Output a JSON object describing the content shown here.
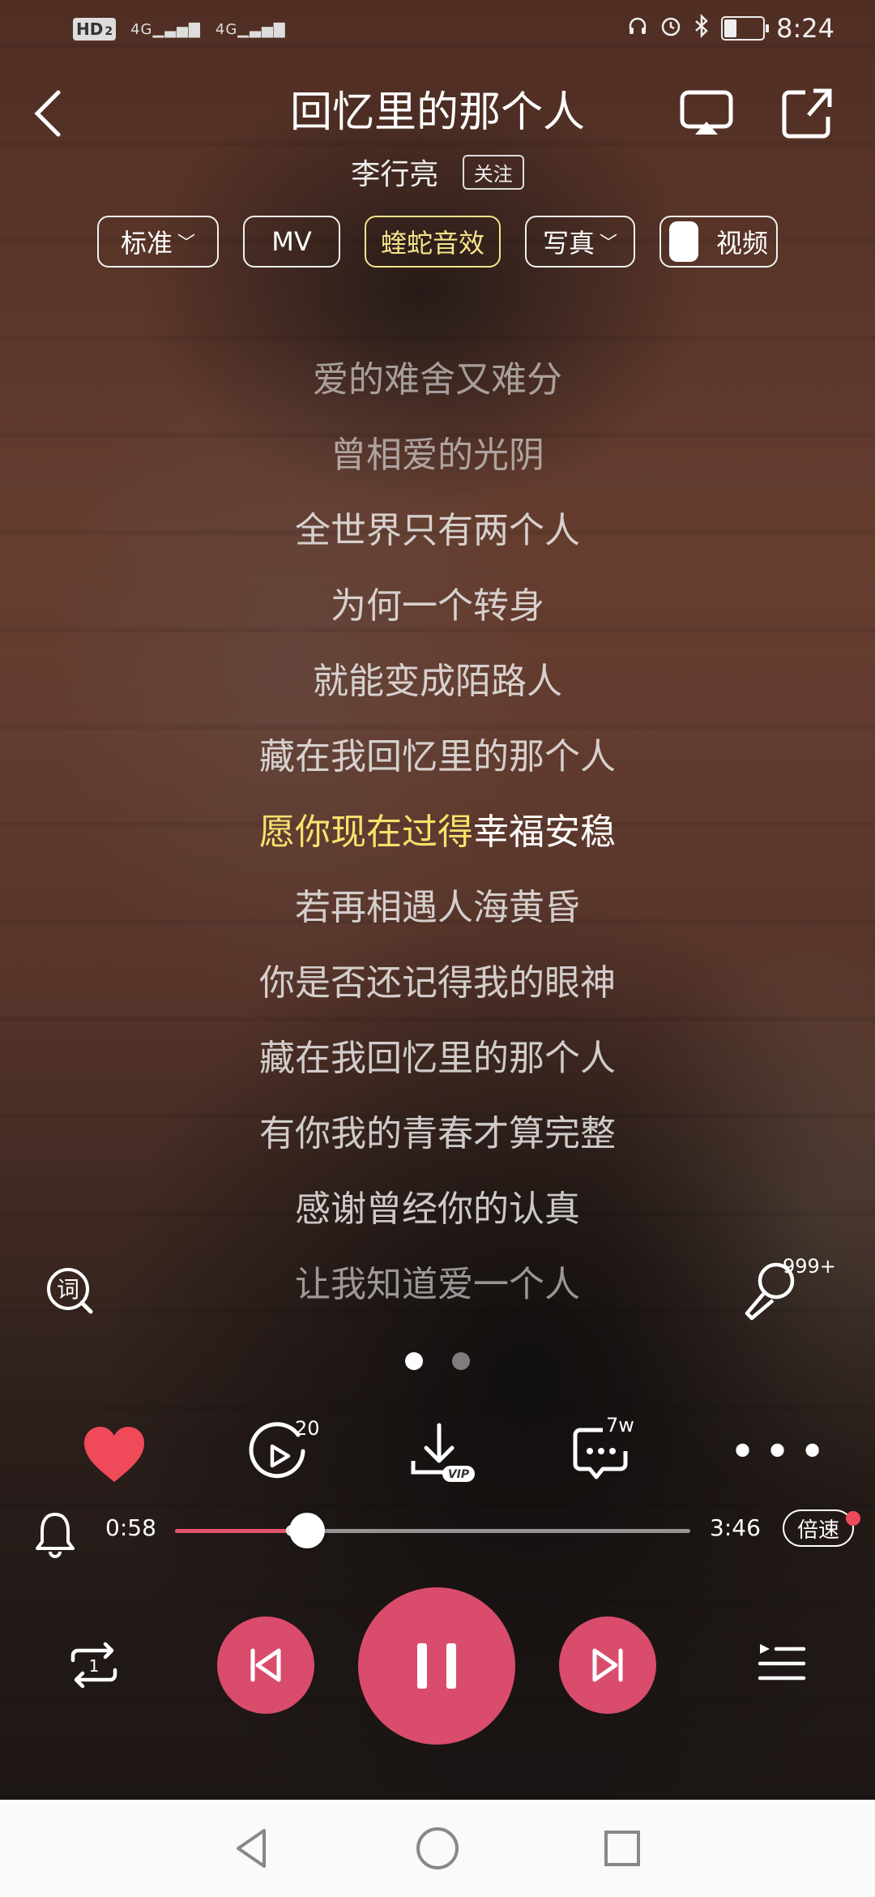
{
  "status_bar": {
    "hd_label": "HD",
    "sim_label": "2",
    "net1": "4G",
    "net2": "4G",
    "time": "8:24"
  },
  "header": {
    "title": "回忆里的那个人",
    "artist": "李行亮",
    "follow_label": "关注"
  },
  "options": {
    "quality": "标准",
    "mv": "MV",
    "effect": "蝰蛇音效",
    "photo": "写真",
    "video": "视频"
  },
  "lyrics": [
    {
      "text": "爱的难舍又难分",
      "state": "dim"
    },
    {
      "text": "曾相爱的光阴",
      "state": "dim"
    },
    {
      "text": "全世界只有两个人",
      "state": "normal"
    },
    {
      "text": "为何一个转身",
      "state": "normal"
    },
    {
      "text": "就能变成陌路人",
      "state": "normal"
    },
    {
      "text": "藏在我回忆里的那个人",
      "state": "normal"
    },
    {
      "text": "愿你现在过得幸福安稳",
      "state": "current",
      "highlighted": "愿你现在过得",
      "rest": "幸福安稳"
    },
    {
      "text": "若再相遇人海黄昏",
      "state": "normal"
    },
    {
      "text": "你是否还记得我的眼神",
      "state": "normal"
    },
    {
      "text": "藏在我回忆里的那个人",
      "state": "normal"
    },
    {
      "text": "有你我的青春才算完整",
      "state": "normal"
    },
    {
      "text": "感谢曾经你的认真",
      "state": "normal"
    },
    {
      "text": "让我知道爱一个人",
      "state": "dim"
    }
  ],
  "lyric_search_glyph": "词",
  "karaoke_count": "999+",
  "page_indicator": {
    "count": 2,
    "active": 0
  },
  "actions": {
    "like_icon": "heart-icon",
    "speed_count": "20",
    "download_tag": "VIP",
    "comment_count": "7w"
  },
  "progress": {
    "current": "0:58",
    "total": "3:46",
    "played_fraction": 0.2566,
    "buffered_fraction": 0.2264,
    "speed_label": "倍速"
  },
  "repeat_badge": "1",
  "colors": {
    "accent": "#d94c6c",
    "lyric_highlight": "#f8e16c",
    "effect_pill": "#f5e58a",
    "progress_played": "#e2546d"
  }
}
